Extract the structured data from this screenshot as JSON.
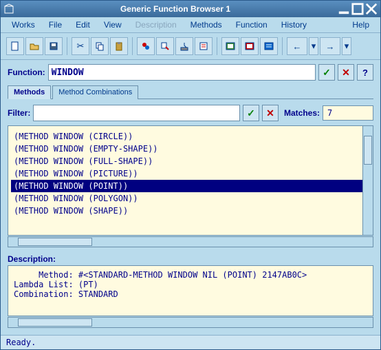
{
  "window": {
    "title": "Generic Function Browser 1"
  },
  "menu": {
    "works": "Works",
    "file": "File",
    "edit": "Edit",
    "view": "View",
    "description": "Description",
    "methods": "Methods",
    "function": "Function",
    "history": "History",
    "help": "Help"
  },
  "function_row": {
    "label": "Function:",
    "value": "WINDOW",
    "check": "✓",
    "x": "✕",
    "q": "?"
  },
  "tabs": {
    "methods": "Methods",
    "method_combinations": "Method Combinations"
  },
  "filter_row": {
    "label": "Filter:",
    "value": "",
    "check": "✓",
    "x": "✕",
    "matches_label": "Matches:",
    "matches_value": "7"
  },
  "list": [
    "(METHOD WINDOW (CIRCLE))",
    "(METHOD WINDOW (EMPTY-SHAPE))",
    "(METHOD WINDOW (FULL-SHAPE))",
    "(METHOD WINDOW (PICTURE))",
    "(METHOD WINDOW (POINT))",
    "(METHOD WINDOW (POLYGON))",
    "(METHOD WINDOW (SHAPE))"
  ],
  "selected_index": 4,
  "description": {
    "label": "Description:",
    "text": "     Method: #<STANDARD-METHOD WINDOW NIL (POINT) 2147AB0C>\nLambda List: (PT)\nCombination: STANDARD"
  },
  "status": "Ready."
}
